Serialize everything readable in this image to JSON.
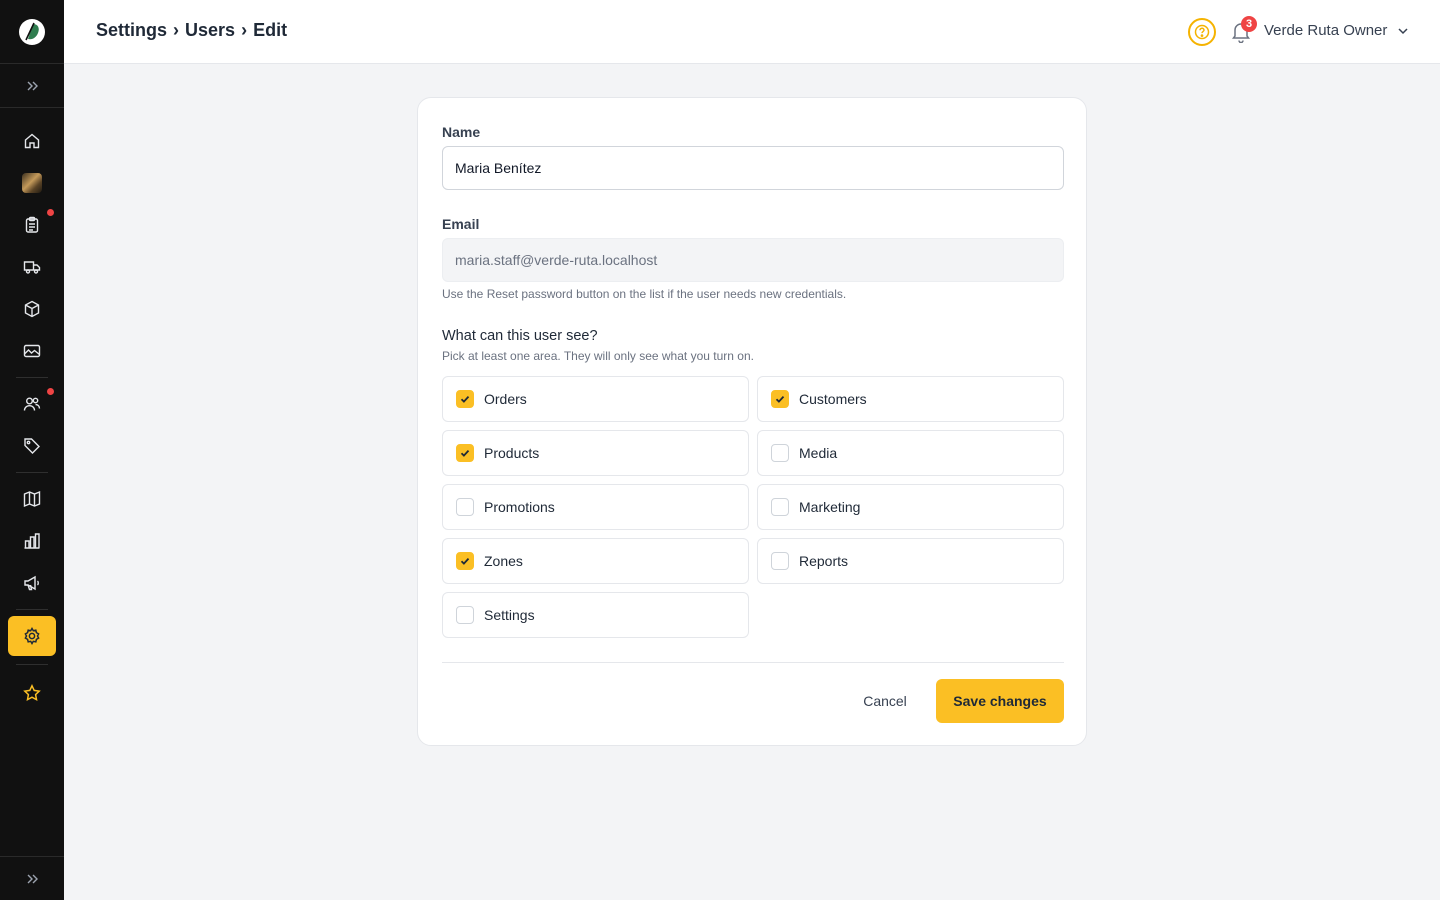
{
  "colors": {
    "accent": "#fbbf24",
    "sidebar_bg": "#111111",
    "badge_red": "#ef4444"
  },
  "header": {
    "breadcrumb": [
      "Settings",
      "Users",
      "Edit"
    ],
    "breadcrumb_separator": "›",
    "notifications_count": "3",
    "user_name": "Verde Ruta Owner"
  },
  "sidebar": {
    "items": [
      {
        "name": "home",
        "icon": "home-icon"
      },
      {
        "name": "media-thumb",
        "icon": "image-thumbnail"
      },
      {
        "name": "orders",
        "icon": "clipboard-icon",
        "dot": true
      },
      {
        "name": "delivery",
        "icon": "truck-icon"
      },
      {
        "name": "products",
        "icon": "box-icon"
      },
      {
        "name": "gallery",
        "icon": "image-icon"
      },
      {
        "name": "customers",
        "icon": "users-icon",
        "dot": true
      },
      {
        "name": "promotions",
        "icon": "tag-icon"
      },
      {
        "name": "zones",
        "icon": "map-icon"
      },
      {
        "name": "reports",
        "icon": "bar-chart-icon"
      },
      {
        "name": "marketing",
        "icon": "megaphone-icon"
      },
      {
        "name": "settings",
        "icon": "gear-icon",
        "active": true
      },
      {
        "name": "favorites",
        "icon": "star-icon"
      }
    ]
  },
  "form": {
    "name_label": "Name",
    "name_value": "Maria Benítez",
    "email_label": "Email",
    "email_value": "maria.staff@verde-ruta.localhost",
    "email_hint": "Use the Reset password button on the list if the user needs new credentials.",
    "permissions_title": "What can this user see?",
    "permissions_hint": "Pick at least one area. They will only see what you turn on.",
    "permissions": [
      {
        "label": "Orders",
        "checked": true
      },
      {
        "label": "Customers",
        "checked": true
      },
      {
        "label": "Products",
        "checked": true
      },
      {
        "label": "Media",
        "checked": false
      },
      {
        "label": "Promotions",
        "checked": false
      },
      {
        "label": "Marketing",
        "checked": false
      },
      {
        "label": "Zones",
        "checked": true
      },
      {
        "label": "Reports",
        "checked": false
      },
      {
        "label": "Settings",
        "checked": false
      }
    ],
    "cancel_label": "Cancel",
    "save_label": "Save changes"
  }
}
